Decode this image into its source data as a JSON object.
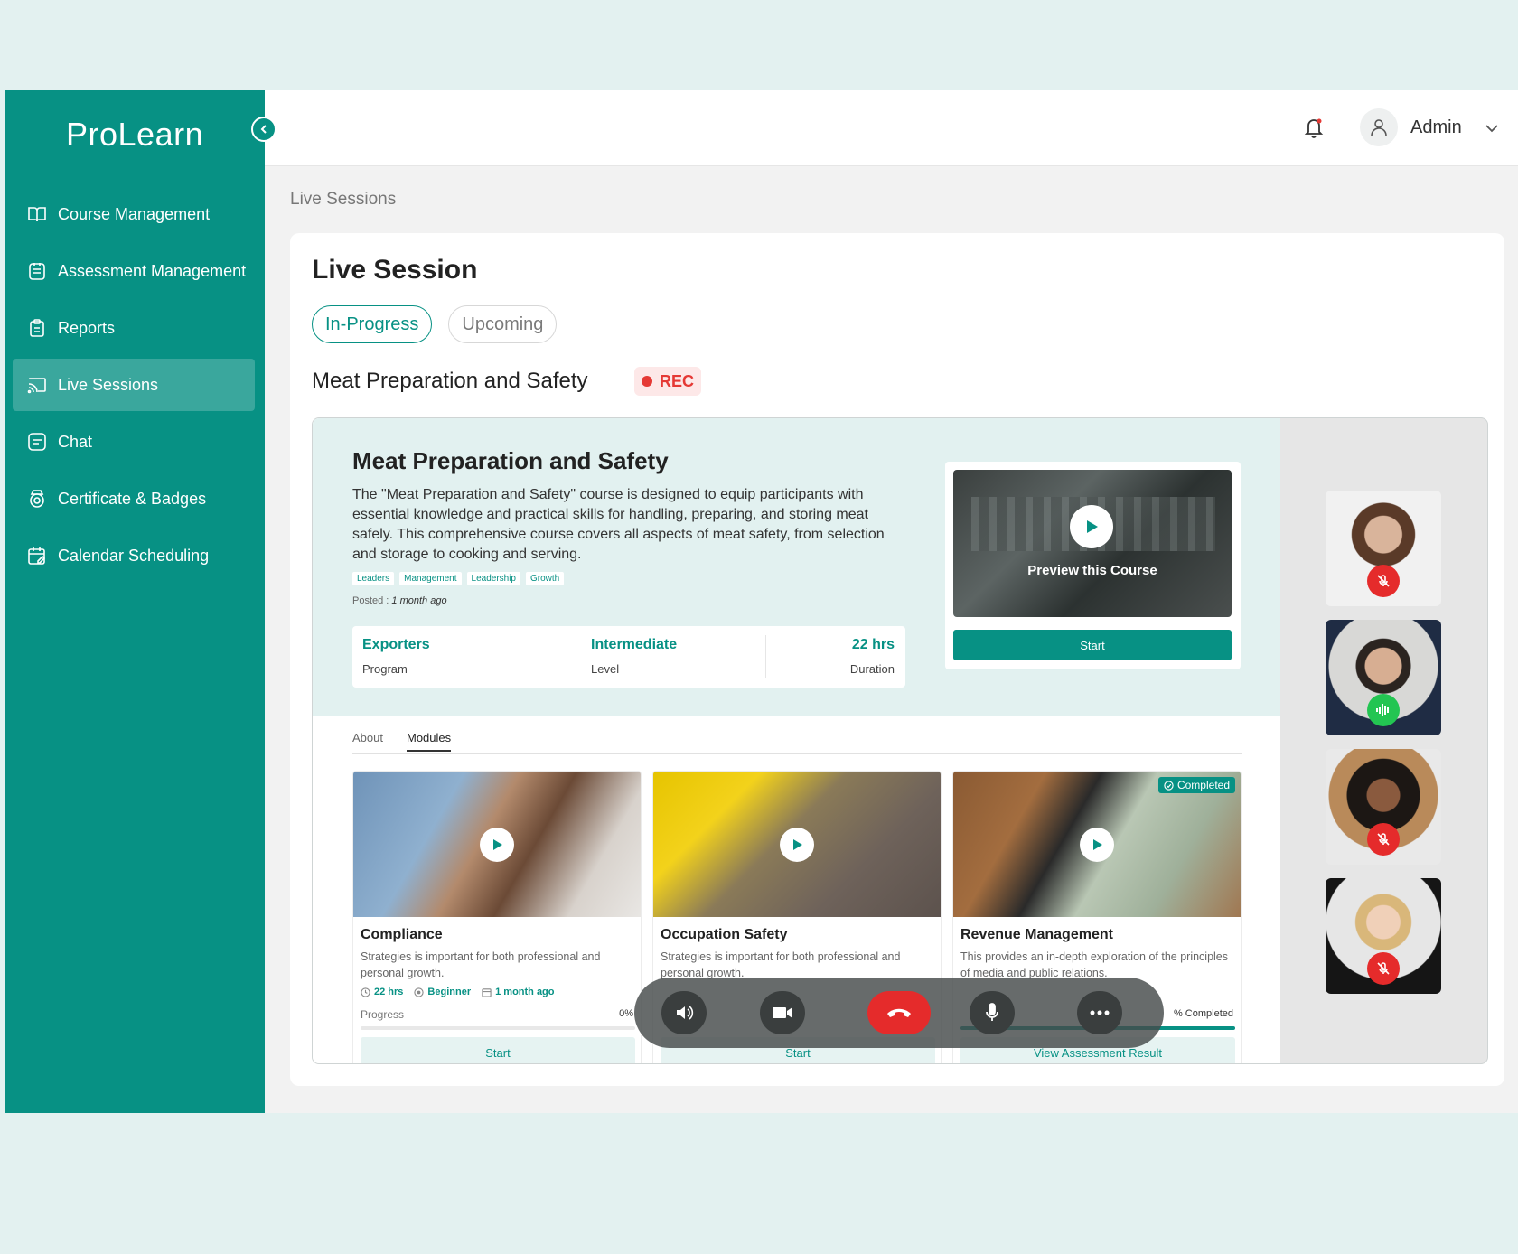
{
  "app": {
    "name": "ProLearn"
  },
  "sidebar": {
    "items": [
      {
        "label": "Course Management",
        "icon": "book-icon"
      },
      {
        "label": "Assessment Management",
        "icon": "assessment-icon"
      },
      {
        "label": "Reports",
        "icon": "clipboard-icon"
      },
      {
        "label": "Live Sessions",
        "icon": "broadcast-icon",
        "active": true
      },
      {
        "label": "Chat",
        "icon": "chat-icon"
      },
      {
        "label": "Certificate & Badges",
        "icon": "badge-icon"
      },
      {
        "label": "Calendar Scheduling",
        "icon": "calendar-icon"
      }
    ]
  },
  "header": {
    "user": "Admin"
  },
  "breadcrumb": "Live Sessions",
  "page": {
    "title": "Live Session",
    "tabs": [
      {
        "label": "In-Progress",
        "active": true
      },
      {
        "label": "Upcoming"
      }
    ],
    "session_name": "Meat Preparation and Safety",
    "rec_label": "REC"
  },
  "course": {
    "title": "Meat Preparation and Safety",
    "description": "The \"Meat Preparation and Safety\" course is designed to equip participants with essential knowledge and practical skills for handling, preparing, and storing meat safely. This comprehensive course covers all aspects of meat safety, from selection and storage to cooking and serving.",
    "tags": [
      "Leaders",
      "Management",
      "Leadership",
      "Growth"
    ],
    "posted_label": "Posted :",
    "posted_value": "1 month ago",
    "stats": [
      {
        "value": "Exporters",
        "label": "Program"
      },
      {
        "value": "Intermediate",
        "label": "Level"
      },
      {
        "value": "22 hrs",
        "label": "Duration"
      }
    ],
    "preview_label": "Preview this Course",
    "start_label": "Start"
  },
  "subtabs": [
    "About",
    "Modules"
  ],
  "modules": [
    {
      "title": "Compliance",
      "description": "Strategies is important for both professional and personal growth.",
      "hours": "22 hrs",
      "level": "Beginner",
      "posted": "1 month ago",
      "progress_label": "Progress",
      "progress_value": "0%",
      "progress": 0,
      "button": "Start"
    },
    {
      "title": "Occupation Safety",
      "description": "Strategies is important for both professional and personal growth.",
      "button": "Start"
    },
    {
      "title": "Revenue Management",
      "description": "This provides an in-depth exploration of the principles of media and public relations.",
      "badge": "Completed",
      "progress_value": "% Completed",
      "progress": 1,
      "button": "View Assessment Result"
    }
  ],
  "participants": [
    {
      "mic": "muted"
    },
    {
      "mic": "talking"
    },
    {
      "mic": "muted"
    },
    {
      "mic": "muted"
    }
  ],
  "controls": [
    "speaker-icon",
    "video-camera-icon",
    "end-call-icon",
    "microphone-icon",
    "more-icon"
  ],
  "colors": {
    "primary": "#079184",
    "rec": "#e53935",
    "end_call": "#e52b2b",
    "talking": "#23c552"
  }
}
